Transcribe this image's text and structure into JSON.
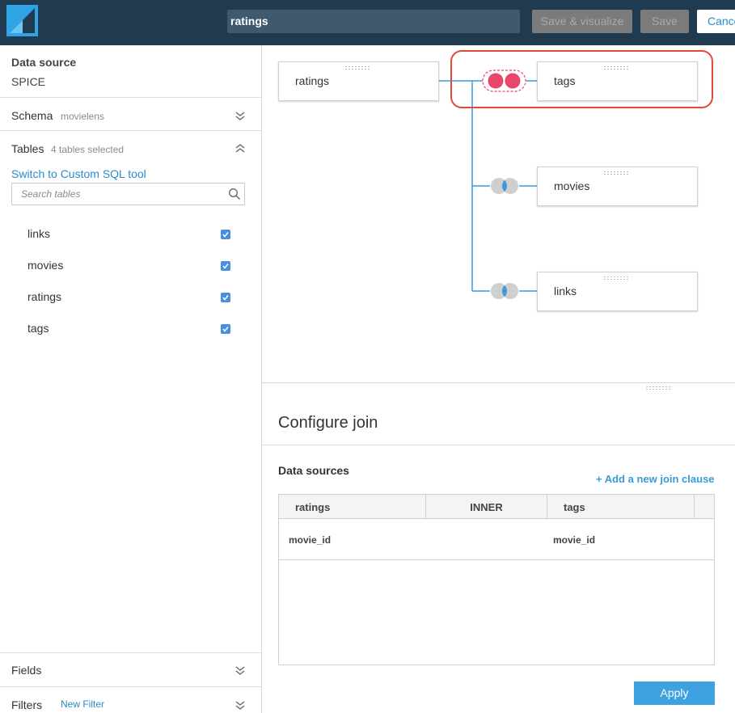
{
  "header": {
    "dataset_name": "ratings",
    "save_visualize_label": "Save & visualize",
    "save_label": "Save",
    "cancel_label": "Cancel"
  },
  "sidebar": {
    "data_source_label": "Data source",
    "data_source_value": "SPICE",
    "schema": {
      "label": "Schema",
      "value": "movielens"
    },
    "tables": {
      "label": "Tables",
      "selected_text": "4 tables selected",
      "custom_sql_link": "Switch to Custom SQL tool",
      "search_placeholder": "Search tables",
      "items": [
        {
          "name": "links",
          "checked": true
        },
        {
          "name": "movies",
          "checked": true
        },
        {
          "name": "ratings",
          "checked": true
        },
        {
          "name": "tags",
          "checked": true
        }
      ]
    },
    "fields_label": "Fields",
    "filters_label": "Filters",
    "new_filter_link": "New Filter"
  },
  "diagram": {
    "nodes": [
      {
        "name": "ratings"
      },
      {
        "name": "tags"
      },
      {
        "name": "movies"
      },
      {
        "name": "links"
      }
    ],
    "join_colors": {
      "inner_selected": "#e8476b",
      "default": "#cfcfcf",
      "line": "#3a9ad9",
      "highlight": "#e04a3a"
    }
  },
  "configure_join": {
    "title": "Configure join",
    "data_sources_label": "Data sources",
    "add_clause_link": "+ Add a new join clause",
    "columns": [
      "ratings",
      "INNER",
      "tags"
    ],
    "clauses": [
      {
        "left": "movie_id",
        "right": "movie_id"
      }
    ],
    "apply_label": "Apply"
  }
}
